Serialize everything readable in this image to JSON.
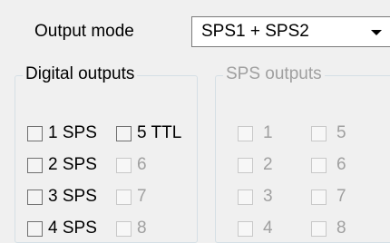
{
  "output_mode": {
    "label": "Output mode",
    "value": "SPS1 + SPS2"
  },
  "digital_outputs": {
    "title": "Digital outputs",
    "col1": [
      "1 SPS",
      "2 SPS",
      "3 SPS",
      "4 SPS"
    ],
    "col2": [
      "5 TTL",
      "6",
      "7",
      "8"
    ]
  },
  "sps_outputs": {
    "title": "SPS outputs",
    "col1": [
      "1",
      "2",
      "3",
      "4"
    ],
    "col2": [
      "5",
      "6",
      "7",
      "8"
    ]
  },
  "colors": {
    "background": "#f0f0f0",
    "disabled_text": "#a0a0a0",
    "group_border": "#d5dfe5"
  }
}
